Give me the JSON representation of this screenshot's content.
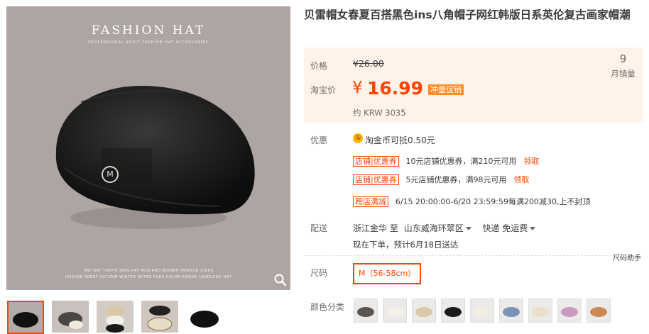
{
  "title": "贝雷帽女春夏百搭黑色ins八角帽子网红韩版日系英伦复古画家帽潮",
  "gallery": {
    "brand": "FASHION HAT",
    "brand_sub": "PROFESSIONAL ADULT FASHION HAT ACCESSORIES",
    "caption1": "HAT DAY YUPPIE SKIN HAT MEN AND WOMEN FASHION JOKER",
    "caption2": "LEISURE BERET AUTUMN WINTER RETRO PURE COLOR ROGUE LANDLORD HAT",
    "emblem": "M",
    "zoom_icon": "magnifier-icon"
  },
  "price": {
    "label_price": "价格",
    "old_price": "¥26.00",
    "label_taobao": "淘宝价",
    "currency": "¥",
    "current": "16.99",
    "promo_badge": "冲量促销",
    "approx": "约 KRW 3035",
    "sales_count": "9",
    "sales_label": "月销量"
  },
  "promo": {
    "label": "优惠",
    "coin_icon": "淘",
    "coin_text": "淘金币可抵0.50元",
    "coupons": [
      {
        "tag_a": "店铺",
        "tag_b": "优惠券",
        "text": "10元店铺优惠券，满210元可用",
        "claim": "领取"
      },
      {
        "tag_a": "店铺",
        "tag_b": "优惠券",
        "text": "5元店铺优惠券，满98元可用",
        "claim": "领取"
      }
    ],
    "cross": {
      "tag": "跨店满减",
      "text": "6/15 20:00:00-6/20 23:59:59每满200减30,上不封顶"
    }
  },
  "delivery": {
    "label": "配送",
    "from": "浙江金华",
    "to_word": "至",
    "to": "山东威海环翠区",
    "method": "快递 免运费",
    "note": "现在下单，预计6月18日送达"
  },
  "size": {
    "helper": "尺码助手",
    "label": "尺码",
    "selected": "M（56-58cm）"
  },
  "color": {
    "label": "颜色分类",
    "swatches": [
      "#5a5553",
      "#f3efe9",
      "#d9c7a8",
      "#1a1a1a",
      "#f2eee2",
      "#7b93b7",
      "#e8dfc8",
      "#c99ac0",
      "#c98a55"
    ]
  },
  "colors": {
    "accent": "#ff4400",
    "price_bg": "#fff2e8",
    "badge": "#ff8c27"
  }
}
